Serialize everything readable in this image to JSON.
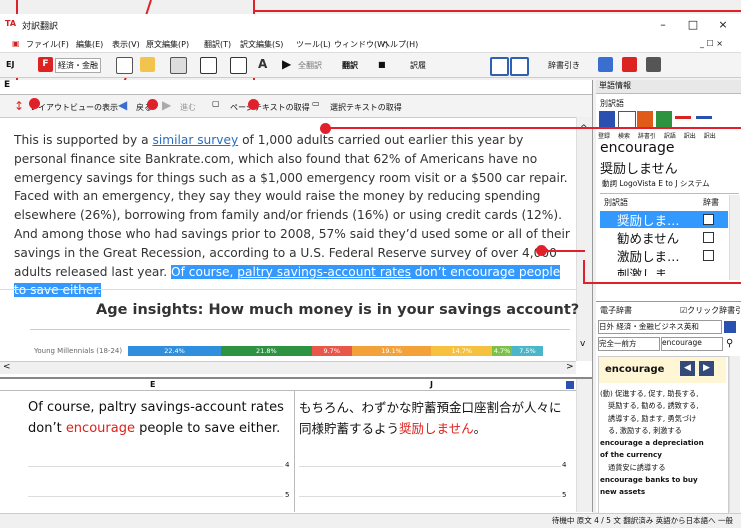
{
  "window": {
    "title": "対訳翻訳",
    "controls": {
      "minimize": "–",
      "maximize": "□",
      "close": "×"
    },
    "inner_controls": "_ ☐ ×"
  },
  "menu": [
    "ファイル(F)",
    "編集(E)",
    "表示(V)",
    "原文編集(P)",
    "翻訳(T)",
    "訳文編集(S)",
    "ツール(L)",
    "ウィンドウ(W)",
    "ヘルプ(H)"
  ],
  "toolbar": {
    "direction": "EJ",
    "field": "経済・金融",
    "translate_all": "全翻訳",
    "translate": "翻訳",
    "stop": "■",
    "web": "訳履",
    "dict_lookup": "辞書引き"
  },
  "left_pane": {
    "tab_label": "E",
    "nav": {
      "layout_view": "レイアウトビューの表示",
      "back": "戻る",
      "forward": "進む",
      "get_page_text": "ページテキストの取得",
      "get_selection_text": "選択テキストの取得"
    },
    "article": {
      "p1_before_link": "This is supported by a ",
      "link1": "similar survey",
      "p1_after_link": " of 1,000 adults carried out earlier this year by personal finance site Bankrate.com, which also found that 62% of Americans have no emergency savings for things such as a $1,000 emergency room visit or a $500 car repair. Faced with an emergency, they say they would raise the money by reducing spending elsewhere (26%), borrowing from family and/or friends (16%) or using credit cards (12%). And among those who had savings prior to 2008, 57% said they’d used some or all of their savings in the Great Recession, according to a U.S. Federal Reserve survey of over 4,000 adults released last year. ",
      "sel_before_link": "Of course, ",
      "sel_link": "paltry savings-account rates",
      "sel_after_link": " don’t encourage people to save either."
    },
    "infographic": {
      "title": "Age insights: How much money is in your savings account?",
      "row_label": "Young Millennials (18-24)",
      "segments": [
        {
          "label": "22.4%",
          "value": 22.4,
          "color": "#2f8fdc"
        },
        {
          "label": "21.8%",
          "value": 21.8,
          "color": "#2e9340"
        },
        {
          "label": "9.7%",
          "value": 9.7,
          "color": "#e9574a"
        },
        {
          "label": "19.1%",
          "value": 19.1,
          "color": "#f3a23a"
        },
        {
          "label": "14.7%",
          "value": 14.7,
          "color": "#f5c13f"
        },
        {
          "label": "4.7%",
          "value": 4.7,
          "color": "#7cc24a"
        },
        {
          "label": "7.5%",
          "value": 7.5,
          "color": "#49b7c9"
        }
      ]
    }
  },
  "bottom_pane": {
    "col_e": "E",
    "col_j": "J",
    "source_before": "Of course, paltry savings-account rates don’t ",
    "source_highlight": "encourage",
    "source_after": " people to save either.",
    "target_before": "もちろん、わずかな貯蓄預金口座割合が人々に同様貯蓄するよう",
    "target_highlight": "奨励しません",
    "target_after": "。",
    "line_numbers": [
      "4",
      "5"
    ]
  },
  "right_pane": {
    "word_info_title": "単語情報",
    "alt_translation_label": "別訳語",
    "tool_labels": [
      "登録",
      "検索",
      "辞書引",
      "訳語",
      "訳出",
      "訳出",
      "語"
    ],
    "tool_labels2": [
      "",
      "全画",
      "登録",
      "禁止",
      "通常",
      "禁止",
      ""
    ],
    "headword": "encourage",
    "translation": "奨励しません",
    "pos_line": "動詞  LogoVista E to J システム",
    "alt_header_word": "別訳語",
    "alt_header_dict": "辞書",
    "alts": [
      "奨励しま…",
      "勧めません",
      "激励しま…",
      "刺激しま…"
    ],
    "edict_title": "電子辞書",
    "click_lookup": "クリック辞書引",
    "dict_select": "日外 経済・金融ビジネス英和",
    "match_select": "完全一前方",
    "search_value": "encourage",
    "entry_word": "encourage",
    "entry_body": [
      "(動) 促進する, 促す, 助長する,",
      "奨励する, 勧める, 誘致する,",
      "誘導する, 励ます, 勇気づけ",
      "る, 激励する, 刺激する",
      "encourage a depreciation",
      "of the currency",
      "通貨安に誘導する",
      "encourage banks to buy",
      "new assets"
    ]
  },
  "status": "待機中  原文  4 / 5 文  翻訳済み  英語から日本語へ  一般"
}
